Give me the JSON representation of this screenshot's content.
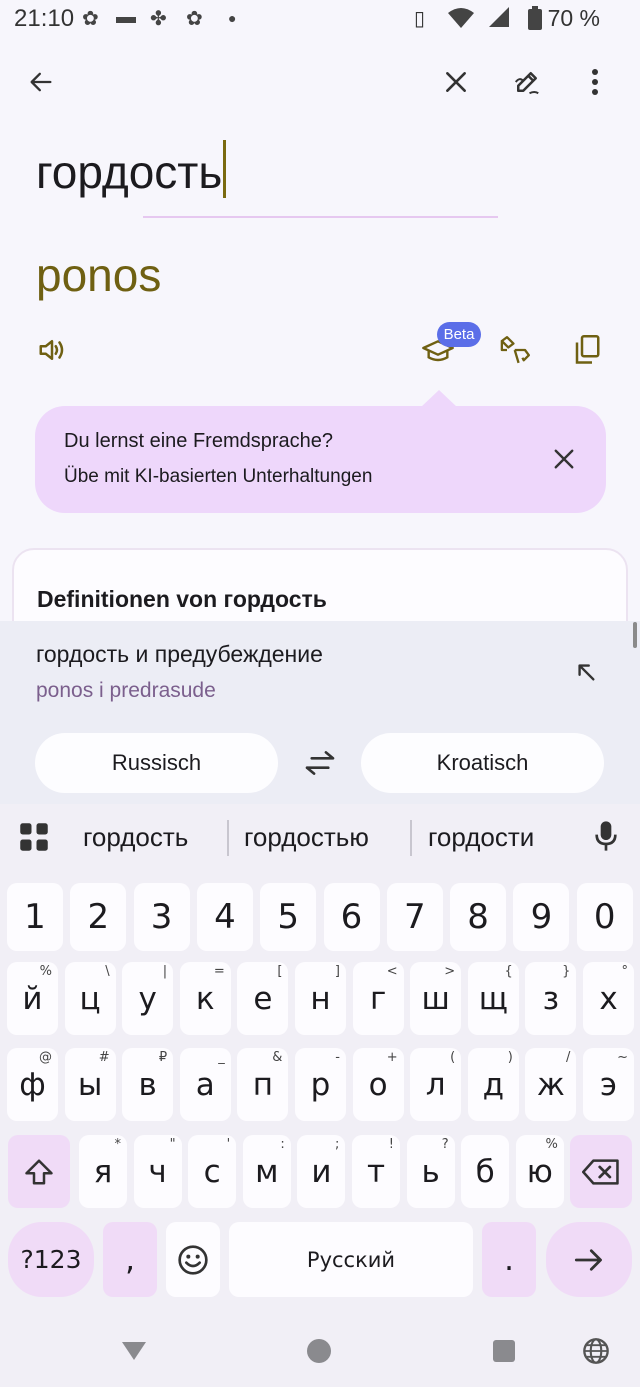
{
  "status_bar": {
    "time": "21:10",
    "battery": "70 %"
  },
  "source": {
    "text": "гордость"
  },
  "translation": {
    "text": "ponos",
    "beta_badge": "Beta"
  },
  "tip": {
    "line1": "Du lernst eine Fremdsprache?",
    "line2": "Übe mit KI-basierten Unterhaltungen"
  },
  "definitions": {
    "title": "Definitionen von гордость"
  },
  "suggestion": {
    "source": "гордость и предубеждение",
    "target": "ponos i predrasude"
  },
  "languages": {
    "from": "Russisch",
    "to": "Kroatisch"
  },
  "keyboard": {
    "suggestions": [
      "гордость",
      "гордостью",
      "гордости"
    ],
    "number_row": [
      "1",
      "2",
      "3",
      "4",
      "5",
      "6",
      "7",
      "8",
      "9",
      "0"
    ],
    "row1": [
      {
        "k": "й",
        "s": "%"
      },
      {
        "k": "ц",
        "s": "\\"
      },
      {
        "k": "у",
        "s": "|"
      },
      {
        "k": "к",
        "s": "="
      },
      {
        "k": "е",
        "s": "["
      },
      {
        "k": "н",
        "s": "]"
      },
      {
        "k": "г",
        "s": "<"
      },
      {
        "k": "ш",
        "s": ">"
      },
      {
        "k": "щ",
        "s": "{"
      },
      {
        "k": "з",
        "s": "}"
      },
      {
        "k": "х",
        "s": "°"
      }
    ],
    "row2": [
      {
        "k": "ф",
        "s": "@"
      },
      {
        "k": "ы",
        "s": "#"
      },
      {
        "k": "в",
        "s": "₽"
      },
      {
        "k": "а",
        "s": "_"
      },
      {
        "k": "п",
        "s": "&"
      },
      {
        "k": "р",
        "s": "-"
      },
      {
        "k": "о",
        "s": "+"
      },
      {
        "k": "л",
        "s": "("
      },
      {
        "k": "д",
        "s": ")"
      },
      {
        "k": "ж",
        "s": "/"
      },
      {
        "k": "э",
        "s": "~"
      }
    ],
    "row3": [
      {
        "k": "я",
        "s": "*"
      },
      {
        "k": "ч",
        "s": "\""
      },
      {
        "k": "с",
        "s": "'"
      },
      {
        "k": "м",
        "s": ":"
      },
      {
        "k": "и",
        "s": ";"
      },
      {
        "k": "т",
        "s": "!"
      },
      {
        "k": "ь",
        "s": "?"
      },
      {
        "k": "б",
        "s": ""
      },
      {
        "k": "ю",
        "s": "%"
      }
    ],
    "symbols_label": "?123",
    "comma": ",",
    "space_label": "Русский",
    "period": "."
  }
}
